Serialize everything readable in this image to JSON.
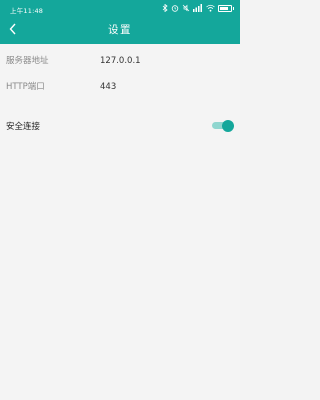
{
  "status_bar": {
    "time": "上午11:48",
    "icons": [
      "bluetooth-icon",
      "alarm-icon",
      "mute-icon",
      "signal-icon",
      "wifi-icon",
      "battery-icon"
    ],
    "battery_level": 0.8
  },
  "header": {
    "title": "设置",
    "back_icon": "chevron-left-icon",
    "color": "#14a79b"
  },
  "settings": {
    "server_address": {
      "label": "服务器地址",
      "value": "127.0.0.1"
    },
    "http_port": {
      "label": "HTTP端口",
      "value": "443"
    },
    "secure_connection": {
      "label": "安全连接",
      "enabled": true
    }
  }
}
